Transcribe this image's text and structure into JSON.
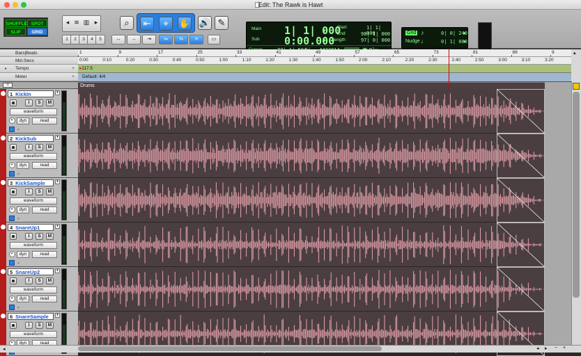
{
  "window": {
    "title": "Edit: The Rawk is Hawt"
  },
  "modes": {
    "shuffle": "SHUFFLE",
    "spot": "SPOT",
    "slip": "SLIP",
    "grid": "GRID"
  },
  "toolbar": {
    "zoom_presets": [
      "1",
      "2",
      "3",
      "4",
      "5"
    ],
    "tools": [
      "zoom-tool",
      "trim-tool",
      "selector-tool",
      "grabber-tool",
      "scrubber-tool",
      "pencil-tool"
    ]
  },
  "counter": {
    "main_label": "Main",
    "sub_label": "Sub",
    "main_value": "1| 1| 000",
    "sub_value": "0:00.000",
    "start_label": "Start",
    "end_label": "End",
    "length_label": "Length",
    "start_value": "1| 1| 000",
    "end_value": "98| 1| 000",
    "length_value": "97| 0| 000",
    "cursor_label": "Cursor",
    "cursor_value": "77| 1| 584",
    "cursor_sample": "-4423814",
    "dly_label": "Dly"
  },
  "grid": {
    "label": "Grid",
    "value": "0| 0| 240",
    "nudge_label": "Nudge",
    "nudge_value": "0| 1| 000"
  },
  "rulers": {
    "bars_beats": "Bars|Beats",
    "min_secs": "Min:Secs",
    "tempo": "Tempo",
    "meter": "Meter",
    "bar_ticks": [
      "1",
      "9",
      "17",
      "25",
      "33",
      "41",
      "49",
      "57",
      "65",
      "73",
      "81",
      "89",
      "9"
    ],
    "time_ticks": [
      "0:00",
      "0:10",
      "0:20",
      "0:30",
      "0:40",
      "0:50",
      "1:00",
      "1:10",
      "1:20",
      "1:30",
      "1:40",
      "1:50",
      "2:00",
      "2:10",
      "2:20",
      "2:30",
      "2:40",
      "2:50",
      "3:00",
      "3:10",
      "3:20"
    ],
    "tempo_value": "117.5",
    "meter_value": "Default: 4/4"
  },
  "clip_group": "Drums",
  "tracks": [
    {
      "number": "1",
      "name": "KickIn",
      "view": "waveform",
      "auto_dyn": "dyn",
      "auto_mode": "read"
    },
    {
      "number": "2",
      "name": "KickSub",
      "view": "waveform",
      "auto_dyn": "dyn",
      "auto_mode": "read"
    },
    {
      "number": "3",
      "name": "KickSample",
      "view": "waveform",
      "auto_dyn": "dyn",
      "auto_mode": "read"
    },
    {
      "number": "4",
      "name": "SnareUp1",
      "view": "waveform",
      "auto_dyn": "dyn",
      "auto_mode": "read"
    },
    {
      "number": "5",
      "name": "SnareUp2",
      "view": "waveform",
      "auto_dyn": "dyn",
      "auto_mode": "read"
    },
    {
      "number": "6",
      "name": "SnareSample",
      "view": "waveform",
      "auto_dyn": "dyn",
      "auto_mode": "read"
    }
  ],
  "track_buttons": {
    "input": "I",
    "solo": "S",
    "mute": "M"
  },
  "colors": {
    "track": "#b51c1c",
    "clip_bg": "#4a3e41",
    "waveform": "#e8a2ad",
    "tempo": "#a9c17b",
    "meter": "#9fb7d1",
    "playhead": "#dd0000"
  }
}
